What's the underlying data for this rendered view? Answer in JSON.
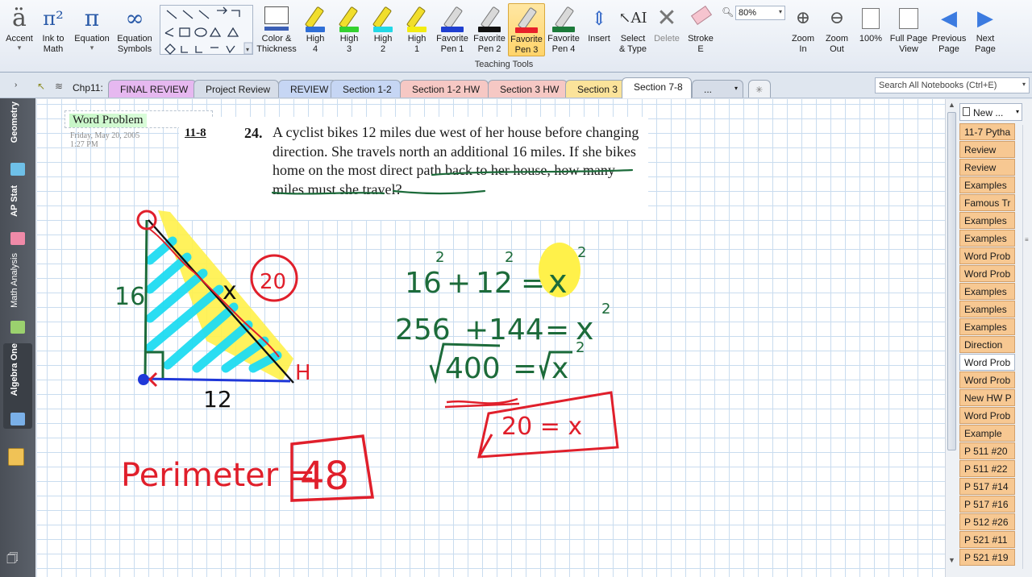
{
  "ribbon": {
    "buttons": [
      {
        "label": "Accent",
        "sub": "▾",
        "icon": "accent-a-icon"
      },
      {
        "label": "Ink to",
        "label2": "Math",
        "icon": "ink-to-math-icon"
      },
      {
        "label": "Equation",
        "sub": "▾",
        "icon": "pi-icon"
      },
      {
        "label": "Equation",
        "label2": "Symbols",
        "sub": "▾",
        "icon": "infinity-icon"
      }
    ],
    "format": {
      "label": "Color &",
      "label2": "Thickness"
    },
    "highlighters": [
      {
        "label": "High",
        "label2": "4",
        "color": "#2f6fd6"
      },
      {
        "label": "High",
        "label2": "3",
        "color": "#35d130"
      },
      {
        "label": "High",
        "label2": "2",
        "color": "#22d8e6"
      },
      {
        "label": "High",
        "label2": "1",
        "color": "#f3ec12"
      }
    ],
    "pens": [
      {
        "label": "Favorite",
        "label2": "Pen 1",
        "color": "#1f3fd0"
      },
      {
        "label": "Favorite",
        "label2": "Pen 2",
        "color": "#111111"
      },
      {
        "label": "Favorite",
        "label2": "Pen 3",
        "color": "#e8202a",
        "selected": true
      },
      {
        "label": "Favorite",
        "label2": "Pen 4",
        "color": "#1c7a3a"
      }
    ],
    "tools": [
      {
        "label": "Insert",
        "label2": ""
      },
      {
        "label": "Select",
        "label2": "& Type"
      },
      {
        "label": "Delete",
        "label2": ""
      },
      {
        "label": "Stroke",
        "label2": "E"
      }
    ],
    "group_label": "Teaching Tools",
    "zoom_value": "80%",
    "view": [
      {
        "label": "Zoom",
        "label2": "In"
      },
      {
        "label": "Zoom",
        "label2": "Out"
      },
      {
        "label": "100%",
        "label2": ""
      },
      {
        "label": "Full Page",
        "label2": "View"
      },
      {
        "label": "Previous",
        "label2": "Page"
      },
      {
        "label": "Next",
        "label2": "Page"
      }
    ]
  },
  "tabbar": {
    "section_group": "Chp11:",
    "tabs": [
      {
        "label": "FINAL REVIEW",
        "color": "#e6b8f0"
      },
      {
        "label": "Project Review",
        "color": "#d6dde8"
      },
      {
        "label": "REVIEW",
        "color": "#c6d6f4"
      },
      {
        "label": "Section 1-2",
        "color": "#c6d6f4"
      },
      {
        "label": "Section 1-2 HW",
        "color": "#f6c8c4"
      },
      {
        "label": "Section 3 HW",
        "color": "#f6c8c4"
      },
      {
        "label": "Section 3",
        "color": "#fbe39a"
      },
      {
        "label": "Section 7-8",
        "color": "#ffffff",
        "active": true
      },
      {
        "label": "...",
        "color": "#d6dde8"
      }
    ],
    "search_placeholder": "Search All Notebooks (Ctrl+E)"
  },
  "notebooks": [
    {
      "label": "Geometry",
      "color": "#6ec0e8"
    },
    {
      "label": "AP Stat",
      "color": "#f08aa8"
    },
    {
      "label": "Math Analysis",
      "color": "#9bd16e"
    },
    {
      "label": "Algebra One",
      "color": "#7ab0e8"
    }
  ],
  "page": {
    "title": "Word Problem",
    "date": "Friday, May 20, 2005",
    "time": "1:27 PM",
    "problem": {
      "section": "11-8",
      "number": "24.",
      "text": "A cyclist bikes 12 miles due west of her house before changing direction. She travels north an additional 16 miles. If she bikes home on the most direct path back to her house, how many miles must she travel?"
    },
    "ink": {
      "side_left": "16",
      "side_bottom": "12",
      "hyp_label": "x",
      "hyp_value": "20",
      "vertex_h": "H",
      "eq1_a": "16",
      "eq1_op": "+",
      "eq1_b": "12",
      "eq1_eq": "=",
      "eq1_x": "x",
      "exp": "2",
      "eq2_a": "256",
      "eq2_op": "+",
      "eq2_b": "144",
      "eq2_eq": "=",
      "eq2_x": "x",
      "eq3_a": "400",
      "eq3_eq": "=",
      "eq3_x": "x",
      "answer": "20 = x",
      "perimeter_label": "Perimeter =",
      "perimeter_value": "48"
    }
  },
  "pagelist": {
    "new_label": "New ...",
    "items": [
      "11-7 Pytha",
      "Review",
      "Review",
      "Examples",
      "Famous Tr",
      "Examples",
      "Examples",
      "Word Prob",
      "Word Prob",
      "Examples",
      "Examples",
      "Examples",
      "Direction",
      "Word Prob",
      "Word Prob",
      "New HW P",
      "Word Prob",
      "Example",
      "P 511 #20",
      "P 511 #22",
      "P 517 #14",
      "P 517 #16",
      "P 512 #26",
      "P 521 #11",
      "P 521 #19"
    ],
    "current_index": 13
  }
}
